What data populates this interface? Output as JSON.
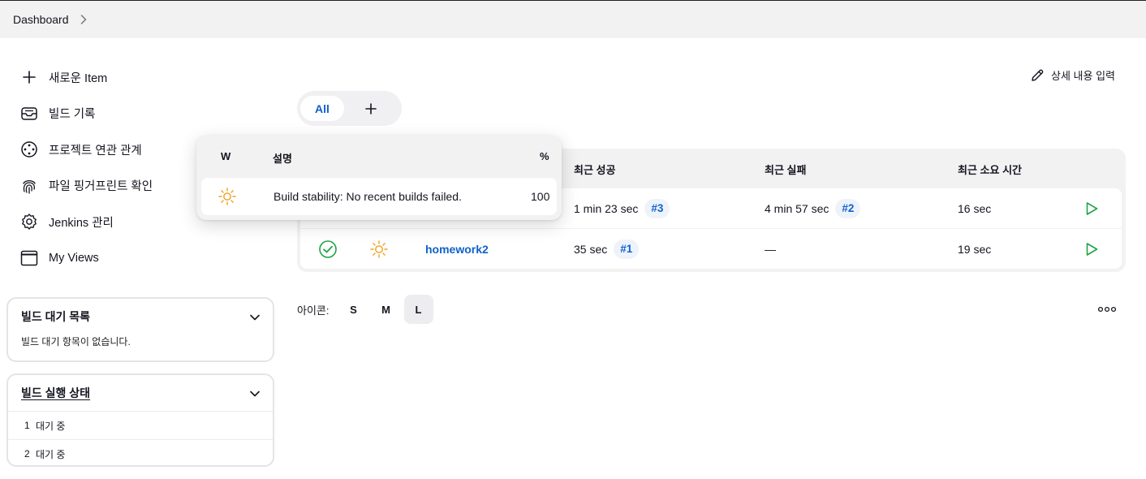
{
  "breadcrumb": {
    "root": "Dashboard"
  },
  "sidebar": {
    "items": [
      {
        "label": "새로운 Item",
        "icon": "plus-icon"
      },
      {
        "label": "빌드 기록",
        "icon": "inbox-icon"
      },
      {
        "label": "프로젝트 연관 관계",
        "icon": "relationship-icon"
      },
      {
        "label": "파일 핑거프린트 확인",
        "icon": "fingerprint-icon"
      },
      {
        "label": "Jenkins 관리",
        "icon": "gear-icon"
      },
      {
        "label": "My Views",
        "icon": "window-icon"
      }
    ]
  },
  "build_queue": {
    "title": "빌드 대기 목록",
    "empty_text": "빌드 대기 항목이 없습니다."
  },
  "executors": {
    "title": "빌드 실행 상태",
    "rows": [
      {
        "num": "1",
        "status": "대기 중"
      },
      {
        "num": "2",
        "status": "대기 중"
      }
    ]
  },
  "edit_description": "상세 내용 입력",
  "tabs": {
    "all": "All"
  },
  "table": {
    "headers": {
      "last_success": "최근 성공",
      "last_failure": "최근 실패",
      "last_duration": "최근 소요 시간"
    },
    "rows": [
      {
        "name": "",
        "last_success": "1 min 23 sec",
        "success_build": "#3",
        "last_failure": "4 min 57 sec",
        "failure_build": "#2",
        "duration": "16 sec"
      },
      {
        "name": "homework2",
        "last_success": "35 sec",
        "success_build": "#1",
        "last_failure": "—",
        "failure_build": "",
        "duration": "19 sec"
      }
    ]
  },
  "icon_size": {
    "label": "아이콘:",
    "options": [
      "S",
      "M",
      "L"
    ],
    "selected": "L"
  },
  "tooltip": {
    "headers": {
      "w": "W",
      "desc": "설명",
      "pct": "%"
    },
    "row": {
      "desc": "Build stability: No recent builds failed.",
      "pct": "100"
    }
  },
  "colors": {
    "accent": "#0f62c9",
    "success": "#1ea446",
    "sun": "#f0a020"
  }
}
